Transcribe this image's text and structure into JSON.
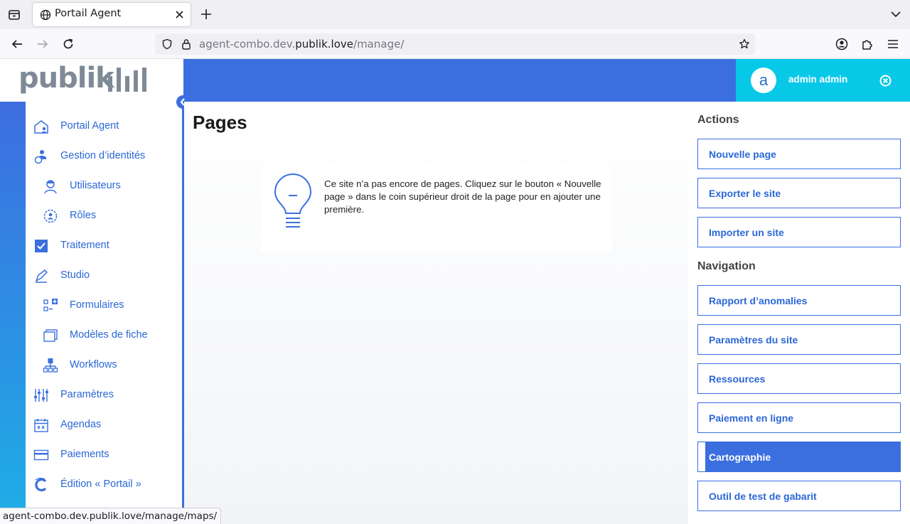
{
  "browser": {
    "tab_title": "Portail Agent",
    "url_prefix": "agent-combo.dev.",
    "url_host": "publik.love",
    "url_path": "/manage/",
    "status_url": "agent-combo.dev.publik.love/manage/maps/"
  },
  "header": {
    "logo_text": "publik",
    "avatar_letter": "a",
    "user_name": "admin admin"
  },
  "sidebar": {
    "items": [
      {
        "label": "Portail Agent",
        "icon": "home-agent-icon"
      },
      {
        "label": "Gestion d’identités",
        "icon": "identity-icon"
      },
      {
        "label": "Utilisateurs",
        "icon": "user-icon"
      },
      {
        "label": "Rôles",
        "icon": "role-icon"
      },
      {
        "label": "Traitement",
        "icon": "checkbox-icon"
      },
      {
        "label": "Studio",
        "icon": "studio-icon"
      },
      {
        "label": "Formulaires",
        "icon": "forms-icon"
      },
      {
        "label": "Modèles de fiche",
        "icon": "card-models-icon"
      },
      {
        "label": "Workflows",
        "icon": "workflow-icon"
      },
      {
        "label": "Paramètres",
        "icon": "settings-sliders-icon"
      },
      {
        "label": "Agendas",
        "icon": "calendar-icon"
      },
      {
        "label": "Paiements",
        "icon": "credit-card-icon"
      },
      {
        "label": "Édition « Portail »",
        "icon": "portal-edit-icon"
      }
    ]
  },
  "main": {
    "title": "Pages",
    "info_text": "Ce site n’a pas encore de pages. Cliquez sur le bouton « Nouvelle page » dans le coin supérieur droit de la page pour en ajouter une première."
  },
  "panel": {
    "actions_heading": "Actions",
    "actions": [
      "Nouvelle page",
      "Exporter le site",
      "Importer un site"
    ],
    "navigation_heading": "Navigation",
    "navigation": [
      "Rapport d’anomalies",
      "Paramètres du site",
      "Ressources",
      "Paiement en ligne",
      "Cartographie",
      "Outil de test de gabarit"
    ],
    "active_navigation": "Cartographie"
  },
  "colors": {
    "primary_blue": "#3b6fdf",
    "user_box_cyan": "#08c8e8",
    "link_blue": "#2b67d6",
    "logo_grey": "#7e8a96"
  }
}
